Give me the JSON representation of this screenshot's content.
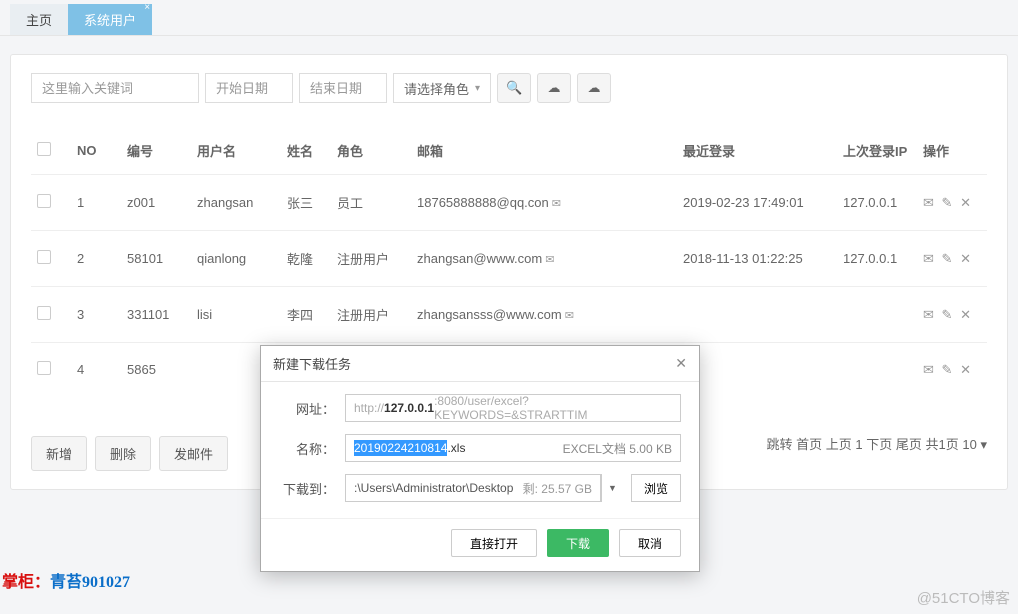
{
  "tabs": {
    "home": "主页",
    "users": "系统用户"
  },
  "toolbar": {
    "keyword_ph": "这里输入关键词",
    "start_ph": "开始日期",
    "end_ph": "结束日期",
    "role_label": "请选择角色"
  },
  "columns": {
    "no": "NO",
    "code": "编号",
    "username": "用户名",
    "name": "姓名",
    "role": "角色",
    "email": "邮箱",
    "last_login": "最近登录",
    "last_ip": "上次登录IP",
    "ops": "操作"
  },
  "rows": [
    {
      "no": "1",
      "code": "z001",
      "username": "zhangsan",
      "name": "张三",
      "role": "员工",
      "email": "18765888888@qq.con",
      "last_login": "2019-02-23 17:49:01",
      "last_ip": "127.0.0.1"
    },
    {
      "no": "2",
      "code": "58101",
      "username": "qianlong",
      "name": "乾隆",
      "role": "注册用户",
      "email": "zhangsan@www.com",
      "last_login": "2018-11-13 01:22:25",
      "last_ip": "127.0.0.1"
    },
    {
      "no": "3",
      "code": "331101",
      "username": "lisi",
      "name": "李四",
      "role": "注册用户",
      "email": "zhangsansss@www.com",
      "last_login": "",
      "last_ip": ""
    },
    {
      "no": "4",
      "code": "5865",
      "username": "",
      "name": "",
      "role": "",
      "email": "",
      "last_login": "",
      "last_ip": ""
    }
  ],
  "bottom_btns": {
    "add": "新增",
    "delete": "删除",
    "mail": "发邮件"
  },
  "pager": {
    "jump": "跳转",
    "first": "首页",
    "prev": "上页",
    "cur": "1",
    "next": "下页",
    "last": "尾页",
    "total": "共1页",
    "size": "10"
  },
  "dialog": {
    "title": "新建下载任务",
    "url_label": "网址：",
    "url_prefix": "http://",
    "url_bold": "127.0.0.1",
    "url_suffix": ":8080/user/excel?KEYWORDS=&STRARTTIM",
    "name_label": "名称：",
    "name_sel": "20190224210814",
    "name_ext": ".xls",
    "name_fmt": "EXCEL文档 5.00 KB",
    "dl_label": "下载到：",
    "dl_path": ":\\Users\\Administrator\\Desktop",
    "dl_free": "剩: 25.57 GB",
    "browse": "浏览",
    "btn_open": "直接打开",
    "btn_dl": "下载",
    "btn_cancel": "取消"
  },
  "wm": {
    "a": "掌柜：",
    "b": "青苔901027",
    "blog": "@51CTO博客"
  }
}
